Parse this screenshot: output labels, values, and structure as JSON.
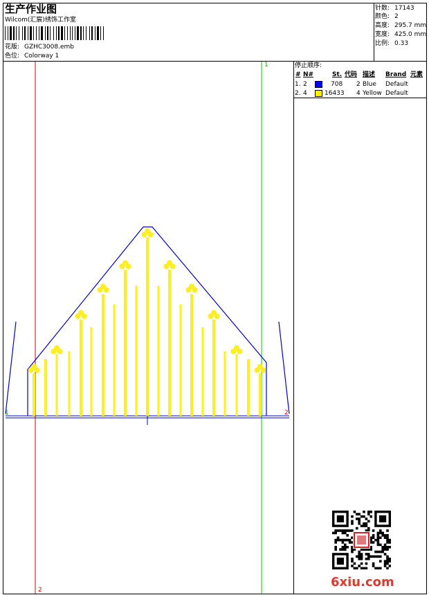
{
  "header": {
    "title": "生产作业图",
    "company": "Wilcom(汇宸)绣饰工作室",
    "design_label": "花版:",
    "design_value": "GZHC3008.emb",
    "colorway_label": "色位:",
    "colorway_value": "Colorway 1"
  },
  "stats": {
    "stitches_label": "针数:",
    "stitches_value": "17143",
    "colors_label": "颜色:",
    "colors_value": "2",
    "height_label": "高度:",
    "height_value": "295.7 mm",
    "width_label": "宽度:",
    "width_value": "425.0 mm",
    "scale_label": "比例:",
    "scale_value": "0.33"
  },
  "stop_sequence": {
    "title": "停止顺序:",
    "columns": [
      "#",
      "N#",
      "St.",
      "代码",
      "描述",
      "Brand",
      "元素"
    ],
    "rows": [
      {
        "num": "1.",
        "needle": "2",
        "swatch": "#0000ee",
        "stitches": "708",
        "code": "2",
        "desc": "Blue",
        "brand": "Default"
      },
      {
        "num": "2.",
        "needle": "4",
        "swatch": "#ffee00",
        "stitches": "16433",
        "code": "4",
        "desc": "Yellow",
        "brand": "Default"
      }
    ]
  },
  "canvas": {
    "marker_top": "1",
    "marker_right": "2",
    "marker_bottom": "2",
    "marker_left": "1"
  },
  "colors": {
    "blue": "#0000cc",
    "yellow": "#ffee22",
    "red_guide": "#dd0000",
    "green_guide": "#00cc00"
  },
  "watermark": "6xiu.com"
}
